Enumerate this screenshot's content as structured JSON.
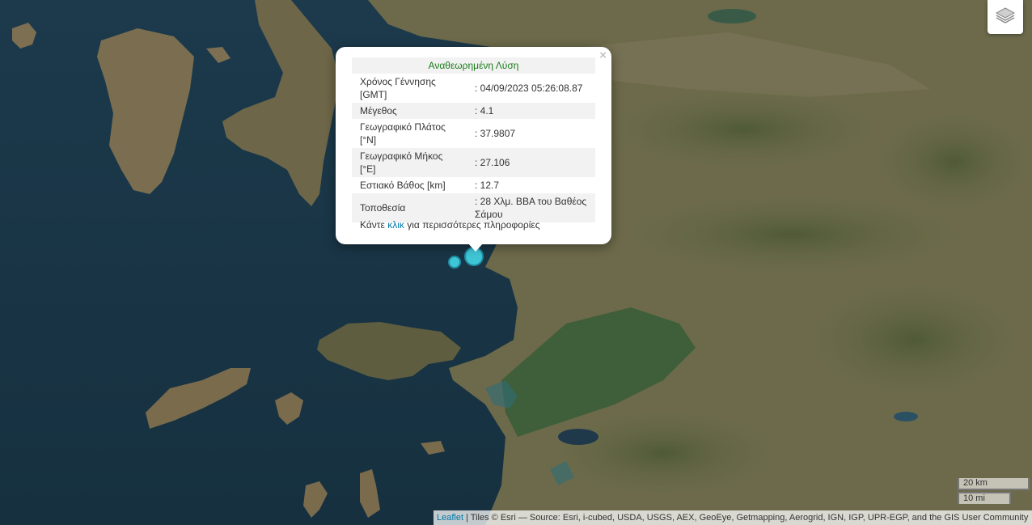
{
  "popup": {
    "title": "Αναθεωρημένη Λύση",
    "rows": [
      {
        "key": "Χρόνος Γέννησης [GMT]",
        "value": ": 04/09/2023 05:26:08.87"
      },
      {
        "key": "Μέγεθος",
        "value": ": 4.1"
      },
      {
        "key": "Γεωγραφικό Πλάτος [°N]",
        "value": ": 37.9807"
      },
      {
        "key": "Γεωγραφικό Μήκος [°E]",
        "value": ": 27.106"
      },
      {
        "key": "Εστιακό Βάθος [km]",
        "value": ": 12.7"
      },
      {
        "key": "Τοποθεσία",
        "value": ": 28 Χλμ. ΒΒΑ του Βαθέος Σάμου"
      }
    ],
    "more_prefix": "Κάντε",
    "more_link": "κλικ",
    "more_suffix": "για περισσότερες πληροφορίες",
    "close_glyph": "×"
  },
  "scale": {
    "km": "20 km",
    "mi": "10 mi"
  },
  "attribution": {
    "leaflet": "Leaflet",
    "text": " | Tiles © Esri — Source: Esri, i-cubed, USDA, USGS, AEX, GeoEye, Getmapping, Aerogrid, IGN, IGP, UPR-EGP, and the GIS User Community"
  },
  "icons": {
    "layers": "layers-icon",
    "close": "close-icon"
  },
  "colors": {
    "sea": "#1e3a4a",
    "land": "#6b6a48",
    "marker": "#3fc6d6"
  }
}
